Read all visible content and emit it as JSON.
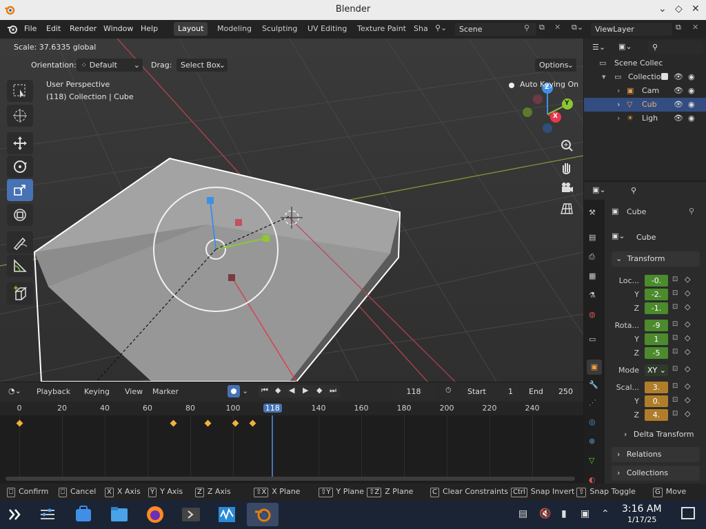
{
  "window": {
    "title": "Blender"
  },
  "menubar": {
    "items": [
      "File",
      "Edit",
      "Render",
      "Window",
      "Help"
    ],
    "workspaces": [
      "Layout",
      "Modeling",
      "Sculpting",
      "UV Editing",
      "Texture Paint",
      "Sha"
    ],
    "active_workspace": "Layout",
    "scene": "Scene",
    "view_layer": "ViewLayer"
  },
  "viewport": {
    "operator_status": "Scale: 37.6335 global",
    "orientation_label": "Orientation:",
    "orientation_value": "Default",
    "drag_label": "Drag:",
    "drag_value": "Select Box",
    "options_label": "Options",
    "perspective": "User Perspective",
    "collection_info": "(118) Collection | Cube",
    "auto_keying": "Auto Keying On",
    "gizmo_axes": {
      "x": "X",
      "y": "Y",
      "z": "Z"
    },
    "colors": {
      "x_axis": "#e8394e",
      "y_axis": "#8dc733",
      "z_axis": "#3f8fe6",
      "select_outline": "#ffffff"
    }
  },
  "timeline": {
    "menus": [
      "Playback",
      "Keying",
      "View",
      "Marker"
    ],
    "current_frame": "118",
    "start_label": "Start",
    "start": "1",
    "end_label": "End",
    "end": "250",
    "ruler": [
      "0",
      "20",
      "40",
      "60",
      "80",
      "100",
      "118",
      "140",
      "160",
      "180",
      "200",
      "220",
      "240"
    ],
    "keyframes": [
      0,
      72,
      88,
      101,
      109
    ]
  },
  "outliner": {
    "root": "Scene Collec",
    "collection": "Collectio",
    "items": [
      {
        "label": "Cam",
        "type": "camera"
      },
      {
        "label": "Cub",
        "type": "mesh",
        "selected": true
      },
      {
        "label": "Ligh",
        "type": "light"
      }
    ]
  },
  "properties": {
    "object_name": "Cube",
    "data_name": "Cube",
    "transform_header": "Transform",
    "location": {
      "label": "Loc...",
      "x": "-0.",
      "y": "-2.",
      "z": "-1."
    },
    "rotation": {
      "label": "Rota...",
      "x": "-9",
      "y": "1",
      "z": "-5"
    },
    "mode_label": "Mode",
    "mode_value": "XY",
    "scale": {
      "label": "Scal...",
      "x": "3.",
      "y": "0.",
      "z": "4."
    },
    "axis_labels": {
      "y": "Y",
      "z": "Z"
    },
    "delta_transform": "Delta Transform",
    "relations": "Relations",
    "collections": "Collections"
  },
  "statusbar": {
    "items": [
      {
        "key": "",
        "label": "Confirm"
      },
      {
        "key": "",
        "label": "Cancel"
      },
      {
        "key": "X",
        "label": "X Axis"
      },
      {
        "key": "Y",
        "label": "Y Axis"
      },
      {
        "key": "Z",
        "label": "Z Axis"
      },
      {
        "key": "⇧X",
        "label": "X Plane"
      },
      {
        "key": "⇧Y",
        "label": "Y Plane"
      },
      {
        "key": "⇧Z",
        "label": "Z Plane"
      },
      {
        "key": "C",
        "label": "Clear Constraints"
      },
      {
        "key": "Ctrl",
        "label": "Snap Invert"
      },
      {
        "key": "⇧",
        "label": "Snap Toggle"
      },
      {
        "key": "G",
        "label": "Move"
      }
    ]
  },
  "taskbar": {
    "time": "3:16 AM",
    "date": "1/17/25"
  }
}
